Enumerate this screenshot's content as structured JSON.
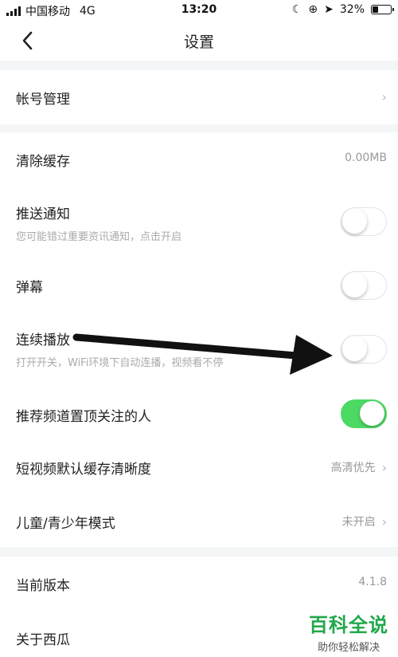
{
  "status_bar": {
    "carrier": "中国移动",
    "network": "4G",
    "time": "13:20",
    "battery": "32%"
  },
  "nav": {
    "title": "设置"
  },
  "rows": {
    "account": {
      "label": "帐号管理"
    },
    "clear_cache": {
      "label": "清除缓存",
      "value": "0.00MB"
    },
    "push": {
      "label": "推送通知",
      "sub": "您可能错过重要资讯通知，点击开启",
      "on": false
    },
    "danmu": {
      "label": "弹幕",
      "on": false
    },
    "autoplay": {
      "label": "连续播放",
      "sub": "打开开关，WiFi环境下自动连播，视频看不停",
      "on": false
    },
    "pin_followed": {
      "label": "推荐频道置顶关注的人",
      "on": true
    },
    "video_quality": {
      "label": "短视频默认缓存清晰度",
      "value": "高清优先"
    },
    "kids_mode": {
      "label": "儿童/青少年模式",
      "value": "未开启"
    },
    "version": {
      "label": "当前版本",
      "value": "4.1.8"
    },
    "about": {
      "label": "关于西瓜"
    }
  },
  "watermark": {
    "title": "百科全说",
    "subtitle": "助你轻松解决"
  },
  "colors": {
    "toggle_on": "#4cd964",
    "watermark_green": "#21a84a",
    "background": "#f4f5f6"
  }
}
